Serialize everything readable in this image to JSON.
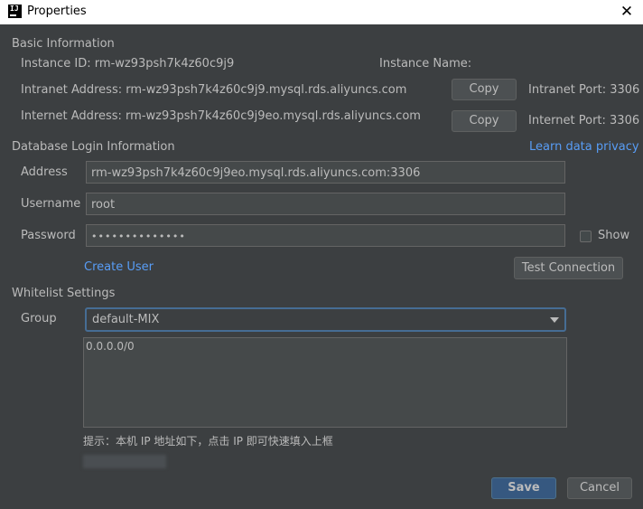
{
  "window": {
    "title": "Properties"
  },
  "basic": {
    "heading": "Basic Information",
    "instance_id": "Instance ID: rm-wz93psh7k4z60c9j9",
    "instance_name": "Instance Name:",
    "intranet_address": "Intranet Address: rm-wz93psh7k4z60c9j9.mysql.rds.aliyuncs.com",
    "internet_address": "Internet Address: rm-wz93psh7k4z60c9j9eo.mysql.rds.aliyuncs.com",
    "copy_label": "Copy",
    "intranet_port": "Intranet Port: 3306",
    "internet_port": "Internet Port: 3306"
  },
  "login": {
    "heading": "Database Login Information",
    "privacy_link": "Learn data privacy",
    "address_label": "Address",
    "address_value": "rm-wz93psh7k4z60c9j9eo.mysql.rds.aliyuncs.com:3306",
    "username_label": "Username",
    "username_value": "root",
    "password_label": "Password",
    "password_value": "••••••••••••••",
    "show_label": "Show",
    "show_checked": false,
    "create_user": "Create User",
    "test_connection": "Test Connection"
  },
  "whitelist": {
    "heading": "Whitelist Settings",
    "group_label": "Group",
    "group_value": "default-MIX",
    "ip_list": "0.0.0.0/0",
    "hint": "提示：本机 IP 地址如下，点击 IP 即可快速填入上框"
  },
  "footer": {
    "save": "Save",
    "cancel": "Cancel"
  },
  "colors": {
    "accent": "#365880",
    "link": "#589df6",
    "background": "#3c3f41"
  }
}
